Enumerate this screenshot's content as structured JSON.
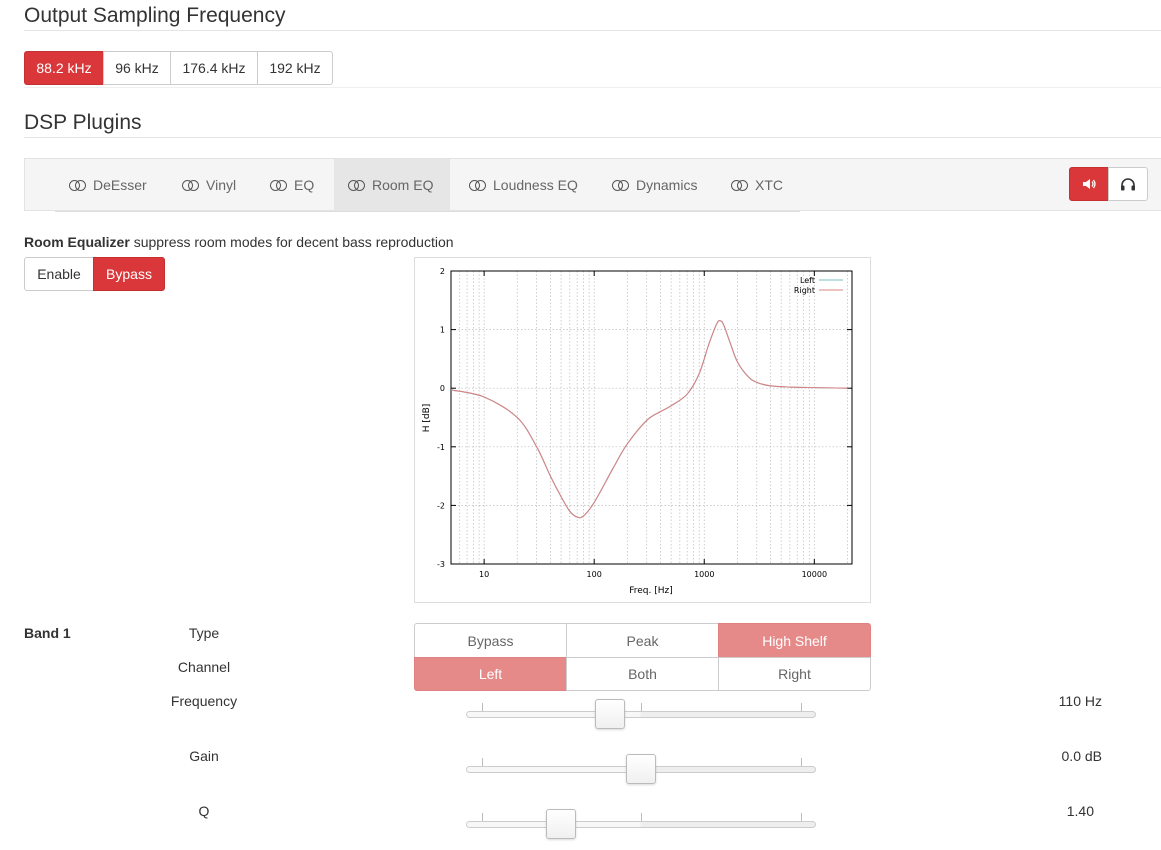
{
  "sampling": {
    "title": "Output Sampling Frequency",
    "options": [
      "88.2 kHz",
      "96 kHz",
      "176.4 kHz",
      "192 kHz"
    ],
    "selected": "88.2 kHz"
  },
  "dsp": {
    "title": "DSP Plugins",
    "tabs": [
      "DeEsser",
      "Vinyl",
      "EQ",
      "Room EQ",
      "Loudness EQ",
      "Dynamics",
      "XTC"
    ],
    "active_tab": "Room EQ",
    "output_buttons": [
      {
        "icon": "speaker-icon",
        "active": true
      },
      {
        "icon": "headphones-icon",
        "active": false
      }
    ]
  },
  "room_eq": {
    "name": "Room Equalizer",
    "description": "suppress room modes for decent bass reproduction",
    "enable_label": "Enable",
    "bypass_label": "Bypass",
    "bypass_active": true
  },
  "band": {
    "title": "Band 1",
    "type_label": "Type",
    "type_options": [
      "Bypass",
      "Peak",
      "High Shelf"
    ],
    "type_selected": "High Shelf",
    "channel_label": "Channel",
    "channel_options": [
      "Left",
      "Both",
      "Right"
    ],
    "channel_selected": "Left",
    "frequency_label": "Frequency",
    "frequency_value": "110 Hz",
    "frequency_position": 0.41,
    "gain_label": "Gain",
    "gain_value": "0.0 dB",
    "gain_position": 0.5,
    "q_label": "Q",
    "q_value": "1.40",
    "q_position": 0.27
  },
  "chart_data": {
    "type": "line",
    "xscale": "log",
    "xlim": [
      5,
      22000
    ],
    "ylim": [
      -3,
      2
    ],
    "xlabel": "Freq. [Hz]",
    "ylabel": "H [dB]",
    "xticks": [
      "10",
      "100",
      "1000",
      "10000"
    ],
    "yticks": [
      "2",
      "1",
      "0",
      "-1",
      "-2",
      "-3"
    ],
    "grid": true,
    "legend_position": "top-right",
    "series": [
      {
        "name": "Left",
        "color": "#7fb8c4",
        "x": [
          5,
          10,
          20,
          30,
          40,
          50,
          60,
          70,
          80,
          100,
          150,
          200,
          300,
          400,
          500,
          700,
          900,
          1100,
          1300,
          1400,
          1500,
          1700,
          2000,
          2500,
          3000,
          4000,
          6000,
          10000,
          20000
        ],
        "y": [
          -0.03,
          -0.15,
          -0.5,
          -1.0,
          -1.5,
          -1.85,
          -2.1,
          -2.2,
          -2.18,
          -1.95,
          -1.35,
          -0.95,
          -0.55,
          -0.4,
          -0.3,
          -0.1,
          0.25,
          0.75,
          1.1,
          1.15,
          1.08,
          0.8,
          0.45,
          0.2,
          0.1,
          0.04,
          0.02,
          0.01,
          0.0
        ]
      },
      {
        "name": "Right",
        "color": "#d88484",
        "x": [
          5,
          10,
          20,
          30,
          40,
          50,
          60,
          70,
          80,
          100,
          150,
          200,
          300,
          400,
          500,
          700,
          900,
          1100,
          1300,
          1400,
          1500,
          1700,
          2000,
          2500,
          3000,
          4000,
          6000,
          10000,
          20000
        ],
        "y": [
          -0.03,
          -0.15,
          -0.5,
          -1.0,
          -1.5,
          -1.85,
          -2.1,
          -2.2,
          -2.18,
          -1.95,
          -1.35,
          -0.95,
          -0.55,
          -0.4,
          -0.3,
          -0.1,
          0.25,
          0.75,
          1.1,
          1.15,
          1.08,
          0.8,
          0.45,
          0.2,
          0.1,
          0.04,
          0.02,
          0.01,
          0.0
        ]
      }
    ]
  }
}
